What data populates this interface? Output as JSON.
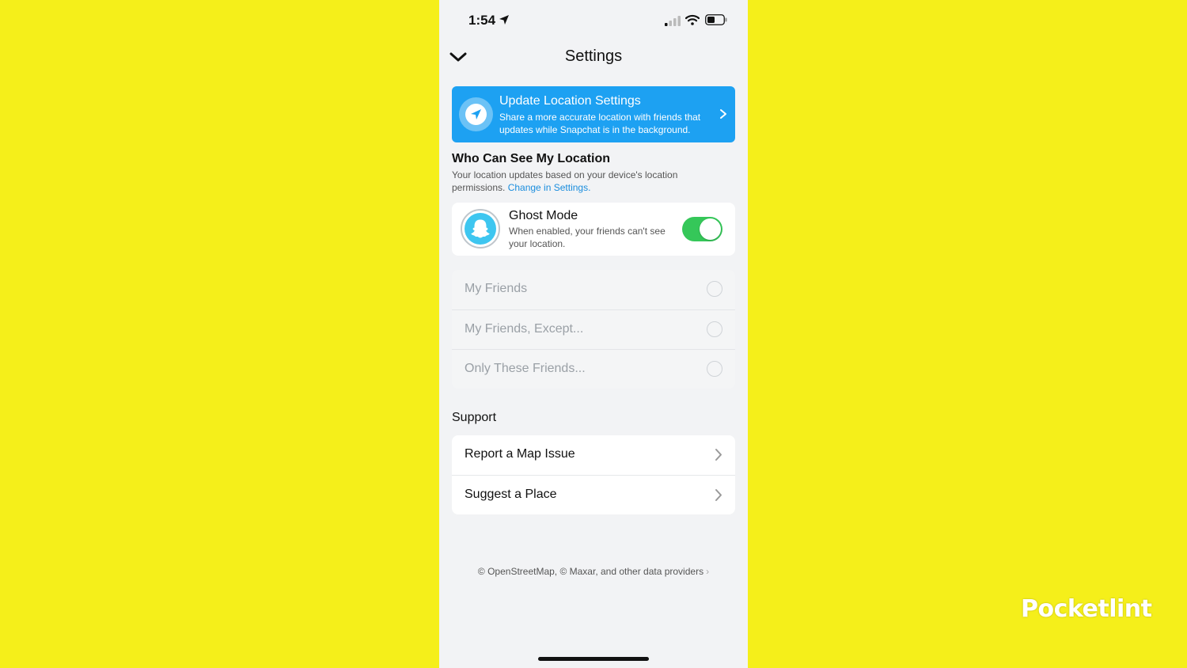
{
  "status_bar": {
    "time": "1:54"
  },
  "nav": {
    "title": "Settings"
  },
  "banner": {
    "title": "Update Location Settings",
    "subtitle": "Share a more accurate location with friends that updates while Snapchat is in the background."
  },
  "who_can_see": {
    "heading": "Who Can See My Location",
    "description": "Your location updates based on your device's location permissions. ",
    "link": "Change in Settings."
  },
  "ghost_mode": {
    "title": "Ghost Mode",
    "subtitle": "When enabled, your friends can't see your location.",
    "enabled": true
  },
  "options": [
    {
      "label": "My Friends",
      "selected": false
    },
    {
      "label": "My Friends, Except...",
      "selected": false
    },
    {
      "label": "Only These Friends...",
      "selected": false
    }
  ],
  "support": {
    "heading": "Support",
    "items": [
      {
        "label": "Report a Map Issue"
      },
      {
        "label": "Suggest a Place"
      }
    ]
  },
  "attribution": "© OpenStreetMap, © Maxar, and other data providers",
  "watermark": "Pocketlint",
  "colors": {
    "background": "#f5ef1a",
    "banner": "#1da1f2",
    "toggle_on": "#35c759",
    "link": "#1a8ddd"
  }
}
